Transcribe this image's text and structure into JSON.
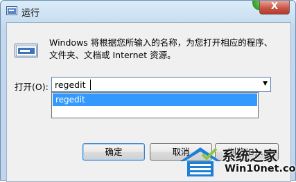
{
  "window": {
    "title": "运行",
    "close_label": "X"
  },
  "description": {
    "line1": "Windows 将根据您所输入的名称，为您打开相应的程序、",
    "line2": "文件夹、文档或 Internet 资源。"
  },
  "open_field": {
    "label": "打开(O):",
    "value": "regedit"
  },
  "autocomplete": {
    "items": [
      "regedit"
    ]
  },
  "buttons": {
    "ok": "确定",
    "cancel": "取消",
    "browse": "浏览(B)..."
  },
  "watermark": {
    "name": "系统之家",
    "url": "Win10net.com"
  },
  "colors": {
    "selection": "#3399ff",
    "close_button": "#c9574a",
    "frame": "#c3d8ee"
  }
}
